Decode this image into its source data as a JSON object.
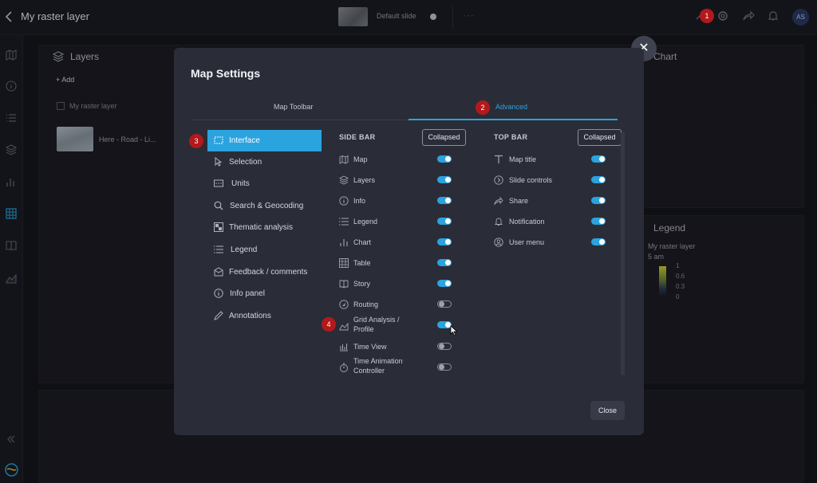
{
  "header": {
    "title": "My raster layer",
    "slide_label": "Default slide",
    "more": "···",
    "avatar": "AS",
    "icons": [
      "back-chevron-icon",
      "settings-gear-icon",
      "share-icon",
      "bell-icon"
    ]
  },
  "left_rail": [
    "map-icon",
    "info-icon",
    "list-icon",
    "layers-icon",
    "chart-icon",
    "table-icon",
    "story-icon",
    "grid-analysis-icon",
    "collapse-icon",
    "globe-logo-icon"
  ],
  "layers_panel": {
    "title": "Layers",
    "add_label": "+ Add",
    "raster_title": "My raster layer",
    "layer_name": "Here - Road - Li..."
  },
  "chart_panel": {
    "title": "Chart"
  },
  "legend_panel": {
    "title": "Legend",
    "layer": "My raster layer",
    "time": "5 am",
    "ticks": [
      "1",
      "0.6",
      "0.3",
      "0"
    ]
  },
  "modal": {
    "title": "Map Settings",
    "tabs": [
      {
        "label": "Map Toolbar",
        "active": false
      },
      {
        "label": "Advanced",
        "active": true
      }
    ],
    "sidebar": [
      {
        "label": "Interface",
        "icon": "interface-icon",
        "active": true
      },
      {
        "label": "Selection",
        "icon": "cursor-icon",
        "active": false
      },
      {
        "label": "Units",
        "icon": "units-icon",
        "active": false
      },
      {
        "label": "Search & Geocoding",
        "icon": "search-icon",
        "active": false
      },
      {
        "label": "Thematic analysis",
        "icon": "thematic-icon",
        "active": false
      },
      {
        "label": "Legend",
        "icon": "legend-icon",
        "active": false
      },
      {
        "label": "Feedback / comments",
        "icon": "feedback-icon",
        "active": false
      },
      {
        "label": "Info panel",
        "icon": "info-icon",
        "active": false
      },
      {
        "label": "Annotations",
        "icon": "pen-icon",
        "active": false
      }
    ],
    "side_bar": {
      "header": "SIDE BAR",
      "collapsed_label": "Collapsed",
      "items": [
        {
          "label": "Map",
          "icon": "map-icon",
          "on": true
        },
        {
          "label": "Layers",
          "icon": "layers-icon",
          "on": true
        },
        {
          "label": "Info",
          "icon": "info-icon",
          "on": true
        },
        {
          "label": "Legend",
          "icon": "legend-icon",
          "on": true
        },
        {
          "label": "Chart",
          "icon": "chart-icon",
          "on": true
        },
        {
          "label": "Table",
          "icon": "table-icon",
          "on": true
        },
        {
          "label": "Story",
          "icon": "story-icon",
          "on": true
        },
        {
          "label": "Routing",
          "icon": "routing-icon",
          "on": false
        },
        {
          "label": "Grid Analysis /\nProfile",
          "icon": "grid-analysis-icon",
          "on": true
        },
        {
          "label": "Time View",
          "icon": "time-view-icon",
          "on": false
        },
        {
          "label": "Time Animation\nController",
          "icon": "timer-icon",
          "on": false
        }
      ]
    },
    "top_bar": {
      "header": "TOP BAR",
      "collapsed_label": "Collapsed",
      "items": [
        {
          "label": "Map title",
          "icon": "title-t-icon",
          "on": true
        },
        {
          "label": "Slide controls",
          "icon": "slide-controls-icon",
          "on": true
        },
        {
          "label": "Share",
          "icon": "share-icon",
          "on": true
        },
        {
          "label": "Notification",
          "icon": "bell-icon",
          "on": true
        },
        {
          "label": "User menu",
          "icon": "user-icon",
          "on": true
        }
      ]
    },
    "close_label": "Close"
  },
  "annotations": [
    "1",
    "2",
    "3",
    "4"
  ],
  "colors": {
    "accent": "#2ba3de",
    "badge": "#b3191c",
    "modal_bg": "#2a2d38",
    "page_bg": "#16171d"
  }
}
